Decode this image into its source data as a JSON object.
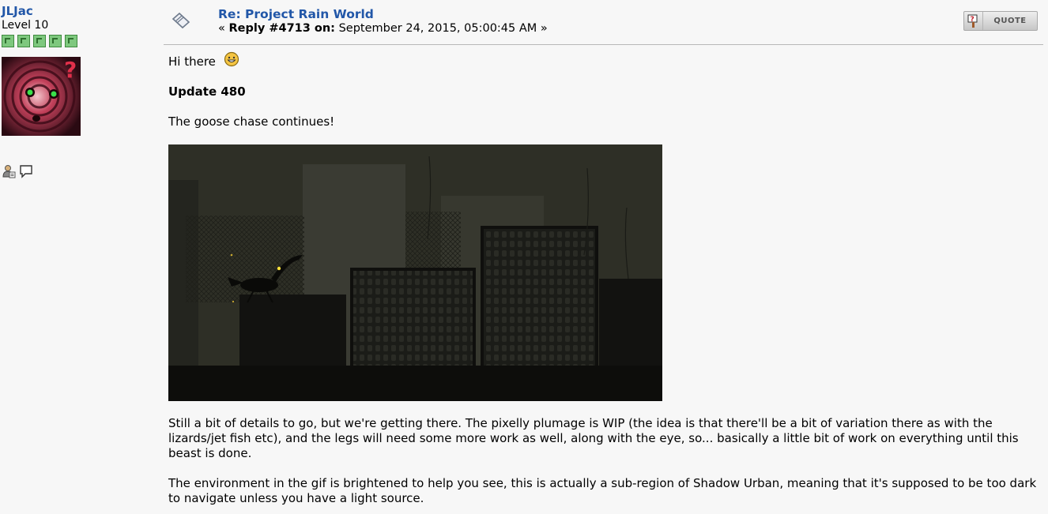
{
  "author": {
    "name": "JLJac",
    "rank": "Level 10",
    "star_count": 5
  },
  "post": {
    "title": "Re: Project Rain World",
    "meta_open": "«",
    "reply_label": "Reply #4713 on:",
    "date": "September 24, 2015, 05:00:45 AM",
    "meta_close": "»",
    "quote_label": "QUOTE"
  },
  "body": {
    "greeting": "Hi there",
    "update_heading": "Update 480",
    "intro": "The goose chase continues!",
    "para1": "Still a bit of details to go, but we're getting there. The pixelly plumage is WIP (the idea is that there'll be a bit of variation there as with the lizards/jet fish etc), and the legs will need some more work as well, along with the eye, so... basically a little bit of work on everything until this beast is done.",
    "para2": "The environment in the gif is brightened to help you see, this is actually a sub-region of Shadow Urban, meaning that it's supposed to be too dark to navigate unless you have a light source."
  },
  "colors": {
    "link_blue": "#2257a8",
    "background": "#f7f7f7",
    "star_green": "#7ec87e"
  },
  "icons": [
    "star-icon",
    "avatar",
    "profile-icon",
    "pm-icon",
    "post-icon",
    "quote-icon",
    "smiley-icon"
  ]
}
